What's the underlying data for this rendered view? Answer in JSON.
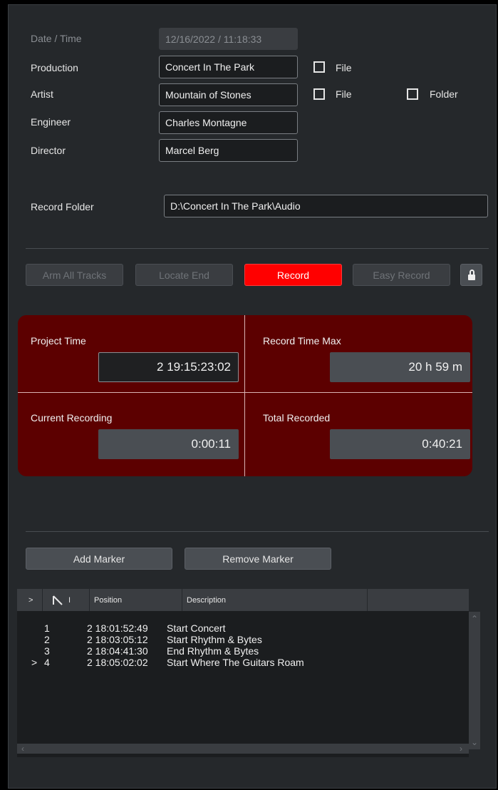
{
  "form": {
    "datetime_label": "Date / Time",
    "datetime_value": "12/16/2022  /  11:18:33",
    "production_label": "Production",
    "production_value": "Concert In The Park",
    "artist_label": "Artist",
    "artist_value": "Mountain of Stones",
    "engineer_label": "Engineer",
    "engineer_value": "Charles Montagne",
    "director_label": "Director",
    "director_value": "Marcel Berg",
    "file_label": "File",
    "folder_label": "Folder",
    "record_folder_label": "Record Folder",
    "record_folder_value": "D:\\Concert In The Park\\Audio"
  },
  "buttons": {
    "arm_all": "Arm All Tracks",
    "locate_end": "Locate End",
    "record": "Record",
    "easy_record": "Easy Record",
    "add_marker": "Add Marker",
    "remove_marker": "Remove Marker"
  },
  "times": {
    "project_time_label": "Project Time",
    "project_time_value": "2 19:15:23:02",
    "record_time_max_label": "Record Time Max",
    "record_time_max_value": "20 h  59 m",
    "current_recording_label": "Current Recording",
    "current_recording_value": "0:00:11",
    "total_recorded_label": "Total Recorded",
    "total_recorded_value": "0:40:21"
  },
  "markers": {
    "col_arrow": ">",
    "col_index": "I",
    "col_position": "Position",
    "col_description": "Description",
    "rows": [
      {
        "cursor": "",
        "index": "1",
        "position": "2 18:01:52:49",
        "description": "Start Concert"
      },
      {
        "cursor": "",
        "index": "2",
        "position": "2 18:03:05:12",
        "description": "Start Rhythm & Bytes"
      },
      {
        "cursor": "",
        "index": "3",
        "position": "2 18:04:41:30",
        "description": "End Rhythm & Bytes"
      },
      {
        "cursor": ">",
        "index": "4",
        "position": "2 18:05:02:02",
        "description": "Start Where The Guitars Roam"
      }
    ]
  },
  "colors": {
    "panel": "#25282b",
    "record": "#ff0000",
    "time_panel": "#5c0000"
  }
}
